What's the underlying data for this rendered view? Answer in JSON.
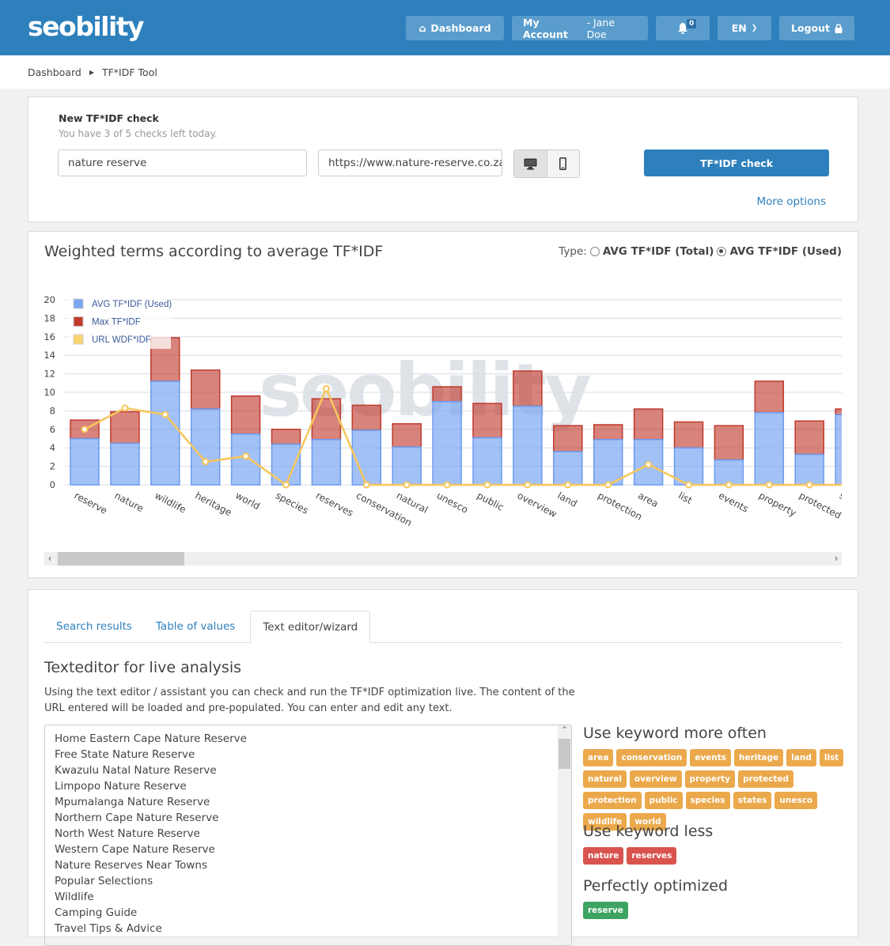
{
  "header": {
    "logo": "seobility",
    "nav": {
      "dashboard": "Dashboard",
      "account_label": "My Account",
      "account_user": " - Jane Doe",
      "notifications_count": "0",
      "language": "EN",
      "logout": "Logout"
    }
  },
  "breadcrumb": [
    "Dashboard",
    "TF*IDF Tool"
  ],
  "check_form": {
    "title": "New TF*IDF check",
    "subtitle": "You have 3 of 5 checks left today.",
    "keyword_value": "nature reserve",
    "url_value": "https://www.nature-reserve.co.za",
    "device_selected": "desktop",
    "submit_label": "TF*IDF check",
    "more_options": "More options"
  },
  "chart_panel": {
    "title": "Weighted terms according to average TF*IDF",
    "type_label": "Type:",
    "type_options": [
      "AVG TF*IDF (Total)",
      "AVG TF*IDF (Used)"
    ],
    "type_selected": "AVG TF*IDF (Used)",
    "watermark": "seobility"
  },
  "chart_data": {
    "type": "bar",
    "stacked": true,
    "title": "Weighted terms according to average TF*IDF",
    "xlabel": "",
    "ylabel": "",
    "ylim": [
      0,
      20
    ],
    "yticks": [
      0,
      2,
      4,
      6,
      8,
      10,
      12,
      14,
      16,
      18,
      20
    ],
    "grid": true,
    "legend_position": "top-left",
    "categories": [
      "reserve",
      "nature",
      "wildlife",
      "heritage",
      "world",
      "species",
      "reserves",
      "conservation",
      "natural",
      "unesco",
      "public",
      "overview",
      "land",
      "protection",
      "area",
      "list",
      "events",
      "property",
      "protected",
      "states"
    ],
    "series": [
      {
        "name": "AVG TF*IDF (Used)",
        "kind": "bar",
        "color": "#7aa6f2",
        "values": [
          5.0,
          4.5,
          11.2,
          8.2,
          5.5,
          4.4,
          4.9,
          5.9,
          4.1,
          9.0,
          5.1,
          8.5,
          3.6,
          4.9,
          4.9,
          4.0,
          2.7,
          7.8,
          3.3,
          7.6
        ]
      },
      {
        "name": "Max TF*IDF",
        "kind": "bar",
        "color": "#c0392b",
        "values": [
          7.0,
          7.9,
          15.9,
          12.4,
          9.6,
          6.0,
          9.3,
          8.6,
          6.6,
          10.6,
          8.8,
          12.3,
          6.4,
          6.5,
          8.2,
          6.8,
          6.4,
          11.2,
          6.9,
          8.2
        ]
      },
      {
        "name": "URL WDF*IDF",
        "kind": "line",
        "color": "#f7c65a",
        "values": [
          6.0,
          8.3,
          7.6,
          2.5,
          3.1,
          0,
          10.4,
          0,
          0,
          0,
          0,
          0,
          0,
          0,
          2.2,
          0,
          0,
          0,
          0,
          0
        ]
      }
    ]
  },
  "tabs": [
    {
      "label": "Search results",
      "active": false
    },
    {
      "label": "Table of values",
      "active": false
    },
    {
      "label": "Text editor/wizard",
      "active": true
    }
  ],
  "editor": {
    "heading": "Texteditor for live analysis",
    "description": "Using the text editor / assistant you can check and run the TF*IDF optimization live. The content of the URL entered will be loaded and pre-populated. You can enter and edit any text.",
    "lines": [
      "Home Eastern Cape Nature Reserve",
      "Free State Nature Reserve",
      "Kwazulu Natal Nature Reserve",
      "Limpopo Nature Reserve",
      "Mpumalanga Nature Reserve",
      "Northern Cape Nature Reserve",
      "North West Nature Reserve",
      "Western Cape Nature Reserve",
      "Nature Reserves Near Towns",
      "Popular Selections",
      "Wildlife",
      "Camping Guide",
      "Travel Tips & Advice"
    ]
  },
  "keywords": {
    "more_often": {
      "title": "Use keyword more often",
      "color": "#eba94b",
      "tags": [
        "area",
        "conservation",
        "events",
        "heritage",
        "land",
        "list",
        "natural",
        "overview",
        "property",
        "protected",
        "protection",
        "public",
        "species",
        "states",
        "unesco",
        "wildlife",
        "world"
      ]
    },
    "less": {
      "title": "Use keyword less",
      "color": "#d9534f",
      "tags": [
        "nature",
        "reserves"
      ]
    },
    "optimized": {
      "title": "Perfectly optimized",
      "color": "#3ea463",
      "tags": [
        "reserve"
      ]
    }
  }
}
